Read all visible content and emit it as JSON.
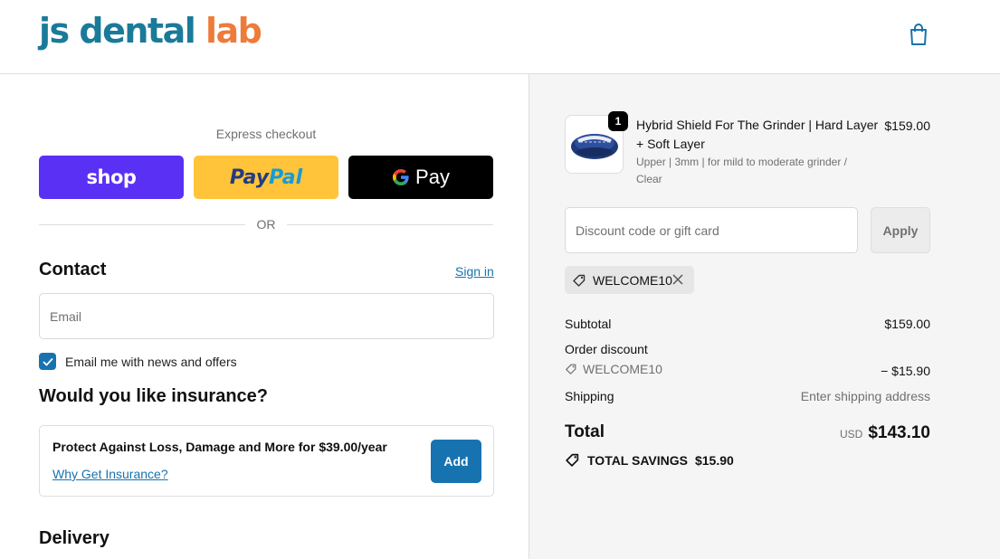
{
  "header": {
    "logo_main": "js dental ",
    "logo_accent": "lab",
    "cart_icon": "shopping-bag-icon",
    "brand_color": "#1a7a9a",
    "accent_color": "#ee7b3a"
  },
  "express": {
    "title": "Express checkout",
    "shop_label": "shop",
    "paypal_part1": "Pay",
    "paypal_part2": "Pal",
    "gpay_label": "Pay",
    "or_label": "OR"
  },
  "contact": {
    "heading": "Contact",
    "sign_in": "Sign in",
    "email_placeholder": "Email",
    "email_value": "",
    "newsletter_label": "Email me with news and offers",
    "newsletter_checked": true
  },
  "insurance": {
    "heading": "Would you like insurance?",
    "text": "Protect Against Loss, Damage and More for $39.00/year",
    "link": "Why Get Insurance?",
    "add_label": "Add"
  },
  "delivery": {
    "heading": "Delivery"
  },
  "summary": {
    "product": {
      "quantity": "1",
      "name": "Hybrid Shield For The Grinder | Hard Layer + Soft Layer",
      "variant": "Upper | 3mm | for mild to moderate grinder / Clear",
      "price": "$159.00"
    },
    "discount_placeholder": "Discount code or gift card",
    "discount_value": "",
    "apply_label": "Apply",
    "applied_code": "WELCOME10",
    "subtotal_label": "Subtotal",
    "subtotal_value": "$159.00",
    "order_discount_label": "Order discount",
    "discount_code": "WELCOME10",
    "discount_amount": "− $15.90",
    "shipping_label": "Shipping",
    "shipping_value": "Enter shipping address",
    "total_label": "Total",
    "currency": "USD",
    "total_value": "$143.10",
    "savings_label": "TOTAL SAVINGS",
    "savings_value": "$15.90"
  },
  "colors": {
    "link_blue": "#1773b0",
    "shop_purple": "#5a31f4",
    "paypal_yellow": "#ffc439",
    "summary_bg": "#f5f5f5"
  }
}
